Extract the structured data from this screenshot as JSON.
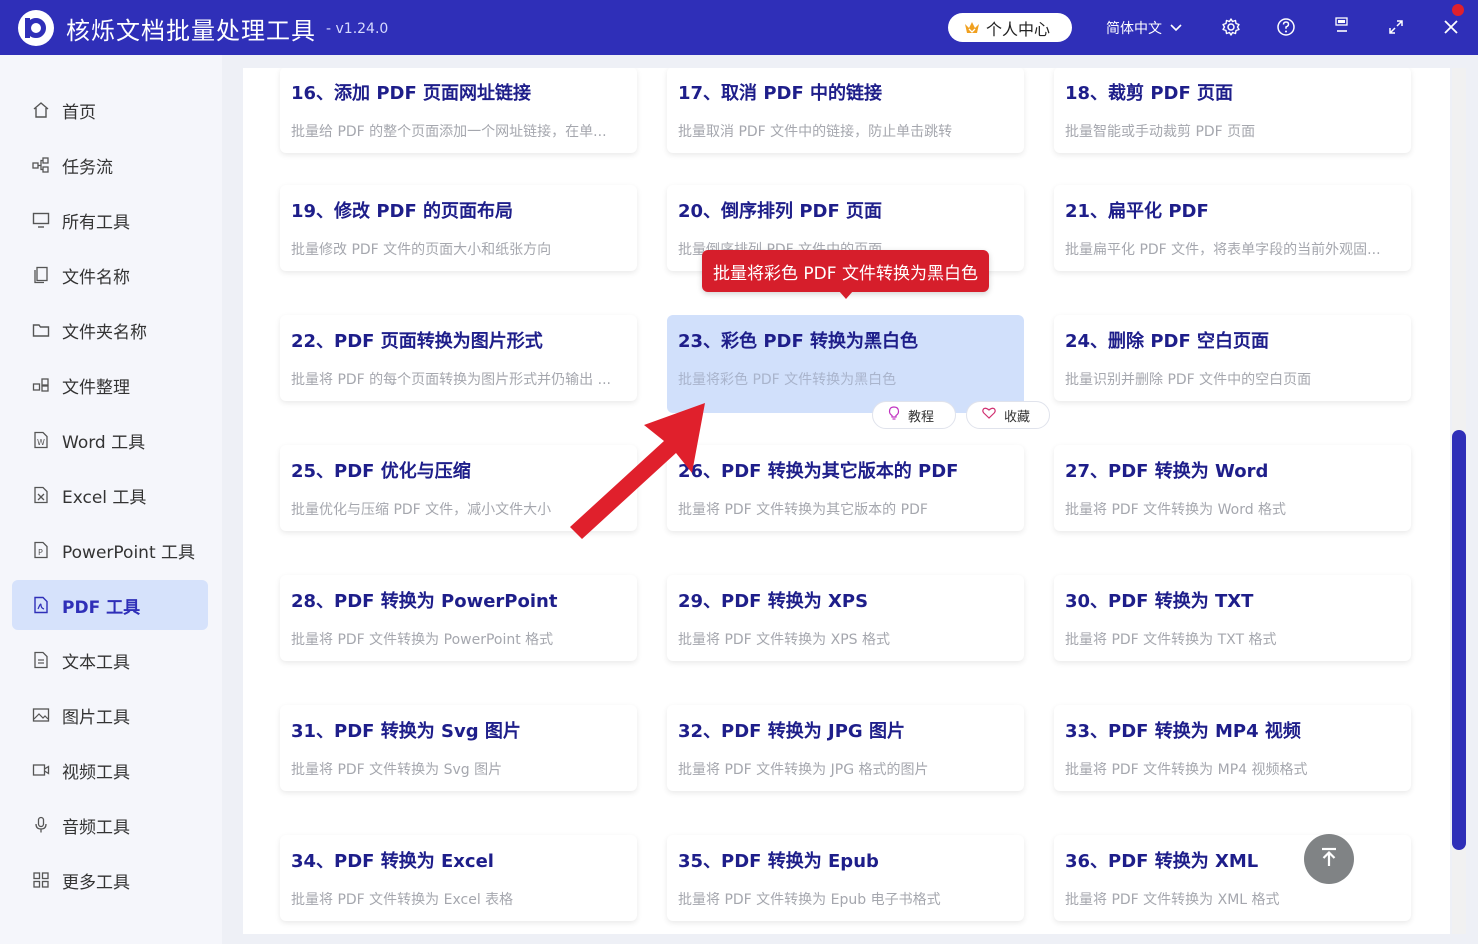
{
  "app": {
    "title": "核烁文档批量处理工具",
    "version": "- v1.24.0",
    "user_center": "个人中心",
    "language": "简体中文"
  },
  "sidebar": {
    "items": [
      {
        "label": "首页",
        "icon": "home-icon"
      },
      {
        "label": "任务流",
        "icon": "workflow-icon"
      },
      {
        "label": "所有工具",
        "icon": "monitor-icon"
      },
      {
        "label": "文件名称",
        "icon": "file-copy-icon"
      },
      {
        "label": "文件夹名称",
        "icon": "folder-icon"
      },
      {
        "label": "文件整理",
        "icon": "organize-icon"
      },
      {
        "label": "Word 工具",
        "icon": "word-icon"
      },
      {
        "label": "Excel 工具",
        "icon": "excel-icon"
      },
      {
        "label": "PowerPoint 工具",
        "icon": "powerpoint-icon"
      },
      {
        "label": "PDF 工具",
        "icon": "pdf-icon"
      },
      {
        "label": "文本工具",
        "icon": "text-file-icon"
      },
      {
        "label": "图片工具",
        "icon": "image-icon"
      },
      {
        "label": "视频工具",
        "icon": "video-icon"
      },
      {
        "label": "音频工具",
        "icon": "microphone-icon"
      },
      {
        "label": "更多工具",
        "icon": "grid-icon"
      }
    ],
    "active": "PDF 工具"
  },
  "tools": [
    {
      "title": "16、添加 PDF 页面网址链接",
      "desc": "批量给 PDF 的整个页面添加一个网址链接，在单..."
    },
    {
      "title": "17、取消 PDF 中的链接",
      "desc": "批量取消 PDF 文件中的链接，防止单击跳转"
    },
    {
      "title": "18、裁剪 PDF 页面",
      "desc": "批量智能或手动裁剪 PDF 页面"
    },
    {
      "title": "19、修改 PDF 的页面布局",
      "desc": "批量修改 PDF 文件的页面大小和纸张方向"
    },
    {
      "title": "20、倒序排列 PDF 页面",
      "desc": "批量倒序排列 PDF 文件中的页面"
    },
    {
      "title": "21、扁平化 PDF",
      "desc": "批量扁平化 PDF 文件，将表单字段的当前外观固..."
    },
    {
      "title": "22、PDF 页面转换为图片形式",
      "desc": "批量将 PDF 的每个页面转换为图片形式并仍输出 ..."
    },
    {
      "title": "23、彩色 PDF 转换为黑白色",
      "desc": "批量将彩色 PDF 文件转换为黑白色"
    },
    {
      "title": "24、删除 PDF 空白页面",
      "desc": "批量识别并删除 PDF 文件中的空白页面"
    },
    {
      "title": "25、PDF 优化与压缩",
      "desc": "批量优化与压缩 PDF 文件，减小文件大小"
    },
    {
      "title": "26、PDF 转换为其它版本的 PDF",
      "desc": "批量将 PDF 文件转换为其它版本的 PDF"
    },
    {
      "title": "27、PDF 转换为 Word",
      "desc": "批量将 PDF 文件转换为 Word 格式"
    },
    {
      "title": "28、PDF 转换为 PowerPoint",
      "desc": "批量将 PDF 文件转换为 PowerPoint 格式"
    },
    {
      "title": "29、PDF 转换为 XPS",
      "desc": "批量将 PDF 文件转换为 XPS 格式"
    },
    {
      "title": "30、PDF 转换为 TXT",
      "desc": "批量将 PDF 文件转换为 TXT 格式"
    },
    {
      "title": "31、PDF 转换为 Svg 图片",
      "desc": "批量将 PDF 文件转换为 Svg 图片"
    },
    {
      "title": "32、PDF 转换为 JPG 图片",
      "desc": "批量将 PDF 文件转换为 JPG 格式的图片"
    },
    {
      "title": "33、PDF 转换为 MP4 视频",
      "desc": "批量将 PDF 文件转换为 MP4 视频格式"
    },
    {
      "title": "34、PDF 转换为 Excel",
      "desc": "批量将 PDF 文件转换为 Excel 表格"
    },
    {
      "title": "35、PDF 转换为 Epub",
      "desc": "批量将 PDF 文件转换为 Epub 电子书格式"
    },
    {
      "title": "36、PDF 转换为 XML",
      "desc": "批量将 PDF 文件转换为 XML 格式"
    }
  ],
  "highlighted_card": {
    "tutorial": "教程",
    "favorite": "收藏"
  },
  "tooltip": "批量将彩色 PDF 文件转换为黑白色",
  "colors": {
    "brand": "#2f2fb8",
    "highlight_card": "#d1e0fb",
    "annotation_red": "#e0202c"
  }
}
